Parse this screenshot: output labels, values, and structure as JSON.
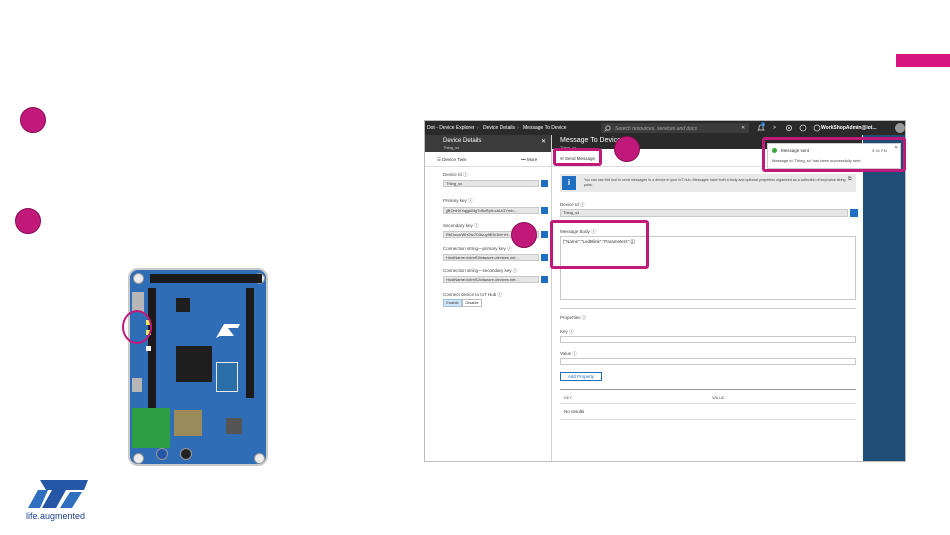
{
  "portal": {
    "breadcrumb": [
      "Dot - Device Explorer",
      "Device Details",
      "Message To Device"
    ],
    "search_placeholder": "Search resources, services and docs",
    "notification_count": "1",
    "account_name": "WorkShopAdmin@iot..."
  },
  "device_details": {
    "title": "Device Details",
    "subtitle": "Thing_sx",
    "toolbar": {
      "device_twin": "Device Twin",
      "more": "••• More"
    },
    "fields": [
      {
        "label": "Device Id ⓘ",
        "value": "Thing_sx"
      },
      {
        "label": "Primary key ⓘ",
        "value": "jjBOnHXXqjgkMgTd5vRpILvALtGYmb..."
      },
      {
        "label": "Secondary key ⓘ",
        "value": "RbDucxrWhOtc7D3uuy9E6r1bt+rH..."
      },
      {
        "label": "Connection string—primary key ⓘ",
        "value": "HostName=iotmS2iotazure-devices.net..."
      },
      {
        "label": "Connection string—secondary key ⓘ",
        "value": "HostName=iotmS2iotazure-devices.net..."
      }
    ],
    "connect_label": "Connect device to IoT Hub ⓘ",
    "enable": "Enable",
    "disable": "Disable"
  },
  "message_to_device": {
    "title": "Message To Device",
    "subtitle": "Thing_sx",
    "send_button": "Send Message",
    "info_text": "You can use this tool to send messages to a device in your IoT hub. Messages have both a body and optional properties organized as a collection of key/value string pairs.",
    "device_id_label": "Device Id ⓘ",
    "device_id_value": "Thing_sx",
    "message_body_label": "Message Body ⓘ",
    "message_body_value": "{\"Name\":\"LedBlink\",\"Parameters\":{}}",
    "properties_label": "Properties ⓘ",
    "key_label": "Key ⓘ",
    "value_label": "Value ⓘ",
    "add_property_button": "Add Property",
    "table_headers": [
      "KEY",
      "VALUE"
    ],
    "no_results": "No results"
  },
  "notification": {
    "title": "Message sent",
    "time": "5:34 PM",
    "message": "Message to 'Thing_sx' has been successfully sent."
  },
  "logo": {
    "tagline": "life.augmented"
  },
  "colors": {
    "accent": "#c0197a",
    "azure_blue": "#1e6ec2",
    "portal_dark": "#2a2a2a",
    "board_blue": "#2f6db7"
  }
}
